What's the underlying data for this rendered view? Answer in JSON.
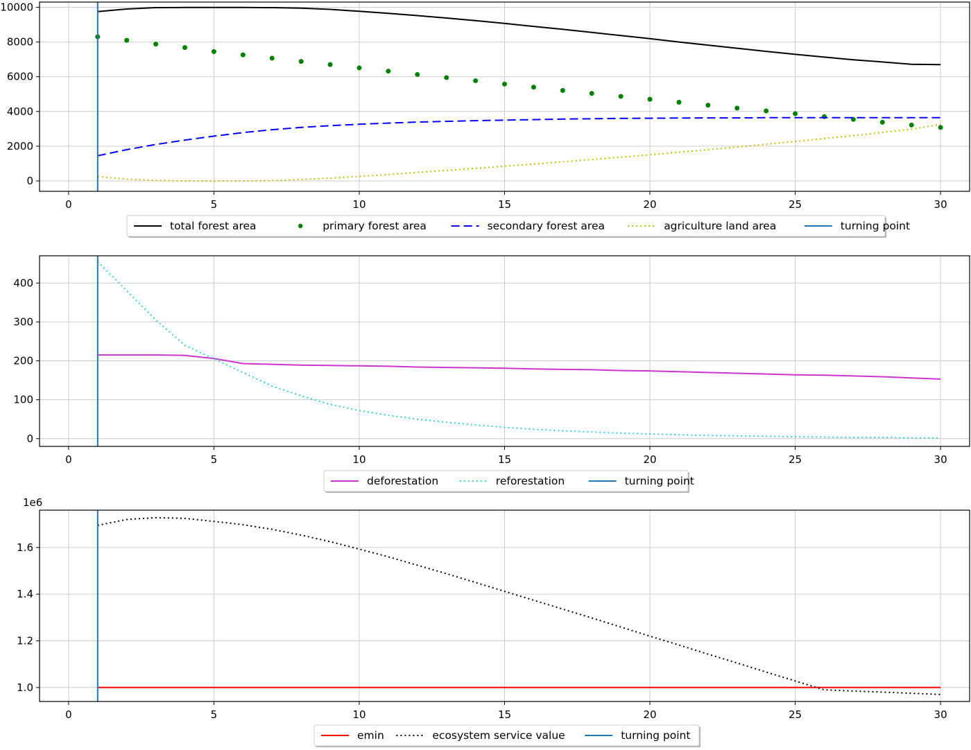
{
  "chart_data": [
    {
      "type": "line",
      "xlim": [
        -1,
        31
      ],
      "ylim": [
        -600,
        10300
      ],
      "xticks": [
        0,
        5,
        10,
        15,
        20,
        25,
        30
      ],
      "xtick_labels": [
        "0",
        "5",
        "10",
        "15",
        "20",
        "25",
        "30"
      ],
      "yticks": [
        0,
        2000,
        4000,
        6000,
        8000,
        10000
      ],
      "ytick_labels": [
        "0",
        "2000",
        "4000",
        "6000",
        "8000",
        "10000"
      ],
      "grid": true,
      "legend_position": "below",
      "x": [
        1,
        2,
        3,
        4,
        5,
        6,
        7,
        8,
        9,
        10,
        11,
        12,
        13,
        14,
        15,
        16,
        17,
        18,
        19,
        20,
        21,
        22,
        23,
        24,
        25,
        26,
        27,
        28,
        29,
        30
      ],
      "series": [
        {
          "name": "total forest area",
          "style": "solid",
          "color": "#000000",
          "values": [
            9750,
            9900,
            9980,
            9990,
            9990,
            9990,
            9980,
            9950,
            9880,
            9770,
            9650,
            9520,
            9380,
            9230,
            9070,
            8900,
            8730,
            8550,
            8370,
            8190,
            8000,
            7820,
            7640,
            7460,
            7290,
            7130,
            6980,
            6850,
            6720,
            6700
          ]
        },
        {
          "name": "primary forest area",
          "style": "dots",
          "color": "#008000",
          "values": [
            8300,
            8100,
            7880,
            7680,
            7450,
            7260,
            7070,
            6880,
            6700,
            6510,
            6320,
            6130,
            5950,
            5770,
            5580,
            5400,
            5210,
            5040,
            4870,
            4700,
            4530,
            4360,
            4190,
            4030,
            3870,
            3700,
            3540,
            3380,
            3220,
            3080
          ]
        },
        {
          "name": "secondary forest area",
          "style": "dashed",
          "color": "#0000ff",
          "values": [
            1450,
            1800,
            2100,
            2350,
            2580,
            2780,
            2950,
            3080,
            3180,
            3260,
            3330,
            3390,
            3430,
            3470,
            3500,
            3530,
            3560,
            3580,
            3600,
            3610,
            3620,
            3630,
            3630,
            3640,
            3640,
            3640,
            3640,
            3640,
            3640,
            3640
          ]
        },
        {
          "name": "agriculture land area",
          "style": "dotted",
          "color": "#bfbf00",
          "values": [
            250,
            100,
            30,
            0,
            -10,
            0,
            20,
            80,
            160,
            260,
            370,
            490,
            600,
            720,
            850,
            970,
            1100,
            1230,
            1370,
            1500,
            1650,
            1800,
            1950,
            2110,
            2270,
            2440,
            2610,
            2790,
            2980,
            3250
          ]
        },
        {
          "name": "turning point",
          "style": "vline",
          "color": "#1f77b4",
          "at": 1
        }
      ]
    },
    {
      "type": "line",
      "xlim": [
        -1,
        31
      ],
      "ylim": [
        -20,
        470
      ],
      "xticks": [
        0,
        5,
        10,
        15,
        20,
        25,
        30
      ],
      "xtick_labels": [
        "0",
        "5",
        "10",
        "15",
        "20",
        "25",
        "30"
      ],
      "yticks": [
        0,
        100,
        200,
        300,
        400
      ],
      "ytick_labels": [
        "0",
        "100",
        "200",
        "300",
        "400"
      ],
      "grid": true,
      "legend_position": "below",
      "x": [
        1,
        2,
        3,
        4,
        5,
        6,
        7,
        8,
        9,
        10,
        11,
        12,
        13,
        14,
        15,
        16,
        17,
        18,
        19,
        20,
        21,
        22,
        23,
        24,
        25,
        26,
        27,
        28,
        29,
        30
      ],
      "series": [
        {
          "name": "deforestation",
          "style": "solid",
          "color": "#cc33cc",
          "values": [
            215,
            215,
            215,
            214,
            206,
            193,
            191,
            189,
            188,
            187,
            186,
            184,
            183,
            182,
            181,
            179,
            178,
            177,
            175,
            174,
            172,
            170,
            168,
            166,
            164,
            163,
            161,
            159,
            156,
            153
          ]
        },
        {
          "name": "reforestation",
          "style": "dotted",
          "color": "#33cccc",
          "values": [
            455,
            380,
            305,
            240,
            205,
            170,
            135,
            110,
            88,
            72,
            60,
            50,
            42,
            35,
            29,
            24,
            20,
            17,
            14,
            12,
            10,
            8,
            7,
            6,
            5,
            4,
            3,
            3,
            2,
            2
          ]
        },
        {
          "name": "turning point",
          "style": "vline",
          "color": "#1f77b4",
          "at": 1
        }
      ]
    },
    {
      "type": "line",
      "xlim": [
        -1,
        31
      ],
      "ylim": [
        0.94,
        1.76
      ],
      "offset_label": "1e6",
      "xticks": [
        0,
        5,
        10,
        15,
        20,
        25,
        30
      ],
      "xtick_labels": [
        "0",
        "5",
        "10",
        "15",
        "20",
        "25",
        "30"
      ],
      "yticks": [
        1.0,
        1.2,
        1.4,
        1.6
      ],
      "ytick_labels": [
        "1.0",
        "1.2",
        "1.4",
        "1.6"
      ],
      "grid": true,
      "legend_position": "below",
      "x": [
        1,
        2,
        3,
        4,
        5,
        6,
        7,
        8,
        9,
        10,
        11,
        12,
        13,
        14,
        15,
        16,
        17,
        18,
        19,
        20,
        21,
        22,
        23,
        24,
        25,
        26,
        27,
        28,
        29,
        30
      ],
      "series": [
        {
          "name": "emin",
          "style": "solid",
          "color": "#ff0000",
          "values": [
            1.0,
            1.0,
            1.0,
            1.0,
            1.0,
            1.0,
            1.0,
            1.0,
            1.0,
            1.0,
            1.0,
            1.0,
            1.0,
            1.0,
            1.0,
            1.0,
            1.0,
            1.0,
            1.0,
            1.0,
            1.0,
            1.0,
            1.0,
            1.0,
            1.0,
            1.0,
            1.0,
            1.0,
            1.0,
            1.0
          ]
        },
        {
          "name": "ecosystem service value",
          "style": "dotted",
          "color": "#000000",
          "values": [
            1.695,
            1.72,
            1.728,
            1.725,
            1.712,
            1.698,
            1.678,
            1.653,
            1.625,
            1.593,
            1.56,
            1.524,
            1.488,
            1.45,
            1.412,
            1.374,
            1.336,
            1.298,
            1.259,
            1.22,
            1.182,
            1.143,
            1.105,
            1.066,
            1.028,
            0.99,
            0.985,
            0.98,
            0.975,
            0.97
          ]
        },
        {
          "name": "turning point",
          "style": "vline",
          "color": "#1f77b4",
          "at": 1
        }
      ]
    }
  ]
}
